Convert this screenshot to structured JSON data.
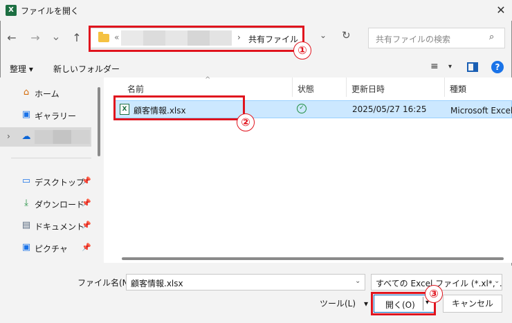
{
  "window": {
    "title": "ファイルを開く",
    "app_icon_letter": "X",
    "close_glyph": "✕"
  },
  "nav": {
    "back_glyph": "←",
    "forward_glyph": "→",
    "recent_glyph": "⌄",
    "up_glyph": "↑",
    "address": {
      "overflow_glyph": "«",
      "separator": "›",
      "current_folder": "共有ファイル"
    },
    "dropdown_glyph": "⌄",
    "refresh_glyph": "↻",
    "search": {
      "placeholder": "共有ファイルの検索",
      "icon_glyph": "⌕"
    }
  },
  "toolbar": {
    "organize": "整理 ▾",
    "new_folder": "新しいフォルダー",
    "view_glyph": "≡",
    "view_caret": "▾",
    "help_glyph": "?"
  },
  "sidebar": {
    "items": [
      {
        "label": "ホーム",
        "icon": "home-icon",
        "glyph": "⌂",
        "pinned": false
      },
      {
        "label": "ギャラリー",
        "icon": "gallery-icon",
        "glyph": "▣",
        "pinned": false
      },
      {
        "label": "",
        "icon": "onedrive-icon",
        "glyph": "☁",
        "pinned": false,
        "expand_glyph": "›"
      },
      {
        "label": "デスクトップ",
        "icon": "desktop-icon",
        "glyph": "▭",
        "pinned": true
      },
      {
        "label": "ダウンロード",
        "icon": "download-icon",
        "glyph": "⤓",
        "pinned": true
      },
      {
        "label": "ドキュメント",
        "icon": "documents-icon",
        "glyph": "▤",
        "pinned": true
      },
      {
        "label": "ピクチャ",
        "icon": "pictures-icon",
        "glyph": "▣",
        "pinned": true
      }
    ],
    "pin_glyph": "📌"
  },
  "columns": {
    "name": "名前",
    "status": "状態",
    "modified": "更新日時",
    "type": "種類",
    "sort_glyph": "^"
  },
  "files": [
    {
      "name": "顧客情報.xlsx",
      "status_glyph": "✓",
      "modified": "2025/05/27 16:25",
      "type": "Microsoft Excel ワ"
    }
  ],
  "bottom": {
    "filename_label": "ファイル名(N):",
    "filename_value": "顧客情報.xlsx",
    "filetype_value": "すべての Excel ファイル (*.xl*;*.xlsx;",
    "caret_glyph": "⌄",
    "tools": "ツール(L)　▾",
    "open": "開く(O)",
    "open_caret": "▾",
    "cancel": "キャンセル"
  },
  "callouts": {
    "one": "①",
    "two": "②",
    "three": "③"
  },
  "colors": {
    "highlight": "#e0141e",
    "selection": "#cce8ff",
    "accent": "#0067c0",
    "excel_green": "#1d6f42"
  }
}
